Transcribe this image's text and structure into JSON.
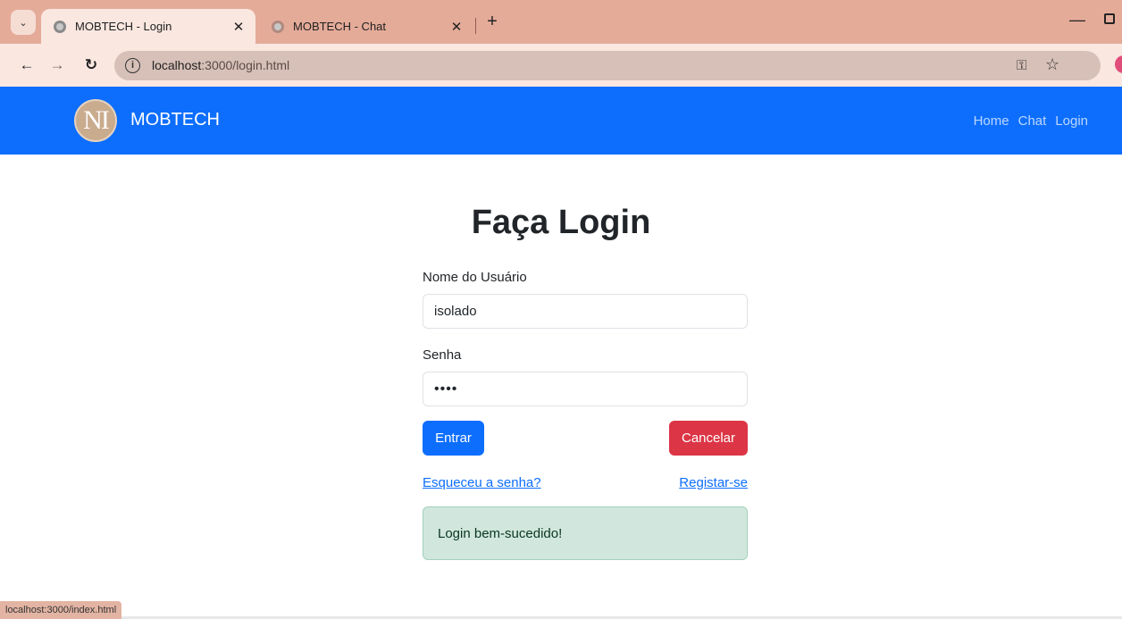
{
  "browser": {
    "tabs": [
      {
        "title": "MOBTECH - Login",
        "active": true
      },
      {
        "title": "MOBTECH - Chat",
        "active": false
      }
    ],
    "url": {
      "host": "localhost",
      "path": ":3000/login.html"
    },
    "status_url": "localhost:3000/index.html"
  },
  "navbar": {
    "brand": "MOBTECH",
    "links": [
      "Home",
      "Chat",
      "Login"
    ]
  },
  "login": {
    "title": "Faça Login",
    "username_label": "Nome do Usuário",
    "username_value": "isolado",
    "password_label": "Senha",
    "password_value": "••••",
    "submit_label": "Entrar",
    "cancel_label": "Cancelar",
    "forgot_label": "Esqueceu a senha?",
    "register_label": "Registar-se",
    "alert": "Login bem-sucedido!"
  },
  "colors": {
    "primary": "#0d6efd",
    "danger": "#dc3545",
    "success_bg": "#d1e7dd"
  }
}
